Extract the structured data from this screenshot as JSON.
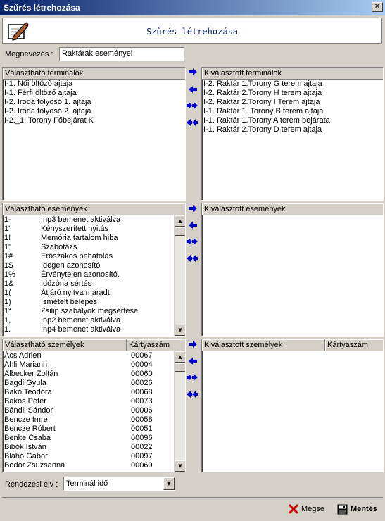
{
  "window": {
    "title": "Szűrés létrehozása",
    "close_glyph": "✕"
  },
  "header": {
    "title": "Szűrés létrehozása",
    "icon": "notepad-pen-icon"
  },
  "name_field": {
    "label": "Megnevezés :",
    "value": "Raktárak eseményei"
  },
  "available_terminals": {
    "header": "Választható terminálok",
    "items": [
      "I-1. Női öltöző ajtaja",
      "I-1. Férfi öltöző ajtaja",
      "I-2. Iroda folyosó 1. ajtaja",
      "I-2. Iroda folyosó 2. ajtaja",
      "I-2._1. Torony Főbejárat K"
    ]
  },
  "selected_terminals": {
    "header": "Kiválasztott terminálok",
    "items": [
      "I-2. Raktár 1.Torony G terem ajtaja",
      "I-2. Raktár 2.Torony H terem ajtaja",
      "I-2. Raktár 2.Torony I Terem ajtaja",
      "I-1. Raktár 1. Torony B terem ajtaja",
      "I-1. Raktár 1.Torony A terem bejárata",
      "I-1. Raktár 2.Torony D terem ajtaja"
    ]
  },
  "available_events": {
    "header": "Választható események",
    "items": [
      {
        "code": "1-",
        "label": "Inp3 bemenet aktiválva"
      },
      {
        "code": "1'",
        "label": "Kényszerített nyitás"
      },
      {
        "code": "1!",
        "label": "Memória tartalom hiba"
      },
      {
        "code": "1\"",
        "label": "Szabotázs"
      },
      {
        "code": "1#",
        "label": "Erőszakos behatolás"
      },
      {
        "code": "1$",
        "label": "Idegen azonosító"
      },
      {
        "code": "1%",
        "label": "Érvénytelen azonosító."
      },
      {
        "code": "1&",
        "label": "Időzóna sértés"
      },
      {
        "code": "1(",
        "label": "Átjáró nyitva maradt"
      },
      {
        "code": "1)",
        "label": "Ismételt belépés"
      },
      {
        "code": "1*",
        "label": "Zsilip szabályok megsértése"
      },
      {
        "code": "1,",
        "label": "Inp2 bemenet aktiválva"
      },
      {
        "code": "1.",
        "label": "Inp4 bemenet aktiválva"
      }
    ]
  },
  "selected_events": {
    "header": "Kiválasztott események",
    "items": []
  },
  "available_persons": {
    "header_name": "Választható személyek",
    "header_card": "Kártyaszám",
    "items": [
      {
        "name": "Ács Adrien",
        "card": "00067"
      },
      {
        "name": "Ahli Mariann",
        "card": "00004"
      },
      {
        "name": "Albecker Zoltán",
        "card": "00060"
      },
      {
        "name": "Bagdi Gyula",
        "card": "00026"
      },
      {
        "name": "Bakó Teodóra",
        "card": "00068"
      },
      {
        "name": "Bakos Péter",
        "card": "00073"
      },
      {
        "name": "Bándli Sándor",
        "card": "00006"
      },
      {
        "name": "Bencze Imre",
        "card": "00058"
      },
      {
        "name": "Bencze Róbert",
        "card": "00051"
      },
      {
        "name": "Benke Csaba",
        "card": "00096"
      },
      {
        "name": "Bibók István",
        "card": "00022"
      },
      {
        "name": "Blahó Gábor",
        "card": "00097"
      },
      {
        "name": "Bodor Zsuzsanna",
        "card": "00069"
      }
    ]
  },
  "selected_persons": {
    "header_name": "Kiválasztott személyek",
    "header_card": "Kártyaszám",
    "items": []
  },
  "transfer_buttons": [
    "move-right-icon",
    "move-left-icon",
    "move-all-right-icon",
    "move-all-left-icon"
  ],
  "sort": {
    "label": "Rendezési elv :",
    "value": "Terminál idő"
  },
  "buttons": {
    "cancel": "Mégse",
    "save": "Mentés"
  },
  "colors": {
    "titlebar": "#0a246a",
    "arrow": "#0000cc",
    "cancel_x": "#cc0000"
  }
}
